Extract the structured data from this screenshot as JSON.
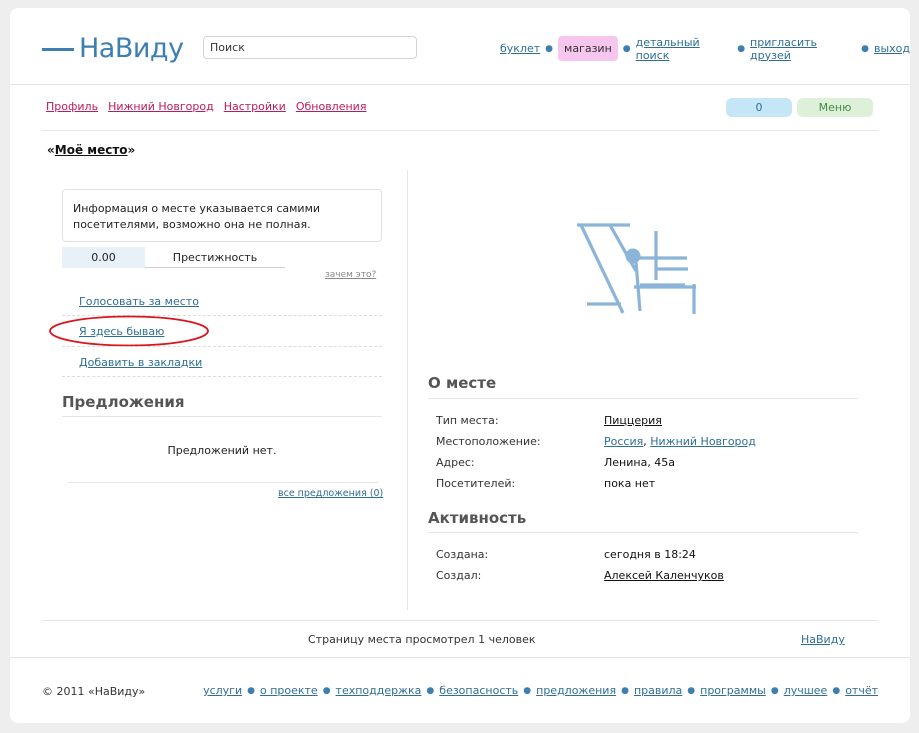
{
  "header": {
    "logo_text": "НаВиду",
    "search_placeholder": "Поиск",
    "nav": [
      {
        "label": "буклет"
      },
      {
        "label": "магазин"
      },
      {
        "label": "детальный поиск"
      },
      {
        "label": "пригласить друзей"
      },
      {
        "label": "выход"
      }
    ],
    "colors": {
      "brand": "#3d7fb0",
      "shop_bg": "#f7c6ee"
    }
  },
  "subnav": {
    "items": [
      {
        "label": "Профиль"
      },
      {
        "label": "Нижний Новгород"
      },
      {
        "label": "Настройки"
      },
      {
        "label": "Обновления"
      }
    ],
    "count": "0",
    "menu": "Меню"
  },
  "place": {
    "title_open": "«",
    "title": "Моё место",
    "title_close": "»",
    "info_text": "Информация о месте указывается самими посетителями, возможно она не полная.",
    "rating_value": "0.00",
    "rating_label": "Престижность",
    "why_link": "зачем это?",
    "actions": [
      {
        "label": "Голосовать за место"
      },
      {
        "label": "Я здесь бываю",
        "highlighted": true
      },
      {
        "label": "Добавить в закладки"
      }
    ]
  },
  "offers": {
    "heading": "Предложения",
    "empty_text": "Предложений нет.",
    "all_link": "все предложения (0)"
  },
  "about": {
    "heading": "О месте",
    "rows": [
      {
        "label": "Тип места:",
        "value": "Пиццерия",
        "link": true
      },
      {
        "label": "Местоположение:",
        "value_parts": [
          "Россия",
          "Нижний Новгород"
        ],
        "separator": ", "
      },
      {
        "label": "Адрес:",
        "value": "Ленина, 45а"
      },
      {
        "label": "Посетителей:",
        "value": "пока нет"
      }
    ]
  },
  "activity": {
    "heading": "Активность",
    "rows": [
      {
        "label": "Создана:",
        "value": "сегодня в 18:24"
      },
      {
        "label": "Создал:",
        "value": "Алексей Каленчуков",
        "link": true
      }
    ]
  },
  "page_footer": {
    "views_text": "Страницу места просмотрел 1 человек",
    "brand_link": "НаВиду"
  },
  "site_footer": {
    "copyright": "© 2011 «НаВиду»",
    "links": [
      {
        "label": "услуги"
      },
      {
        "label": "о проекте"
      },
      {
        "label": "техподдержка"
      },
      {
        "label": "безопасность"
      },
      {
        "label": "предложения"
      },
      {
        "label": "правила"
      },
      {
        "label": "программы"
      },
      {
        "label": "лучшее"
      },
      {
        "label": "отчёт"
      }
    ]
  },
  "icons": {
    "map_placeholder": "map-placeholder-icon"
  }
}
